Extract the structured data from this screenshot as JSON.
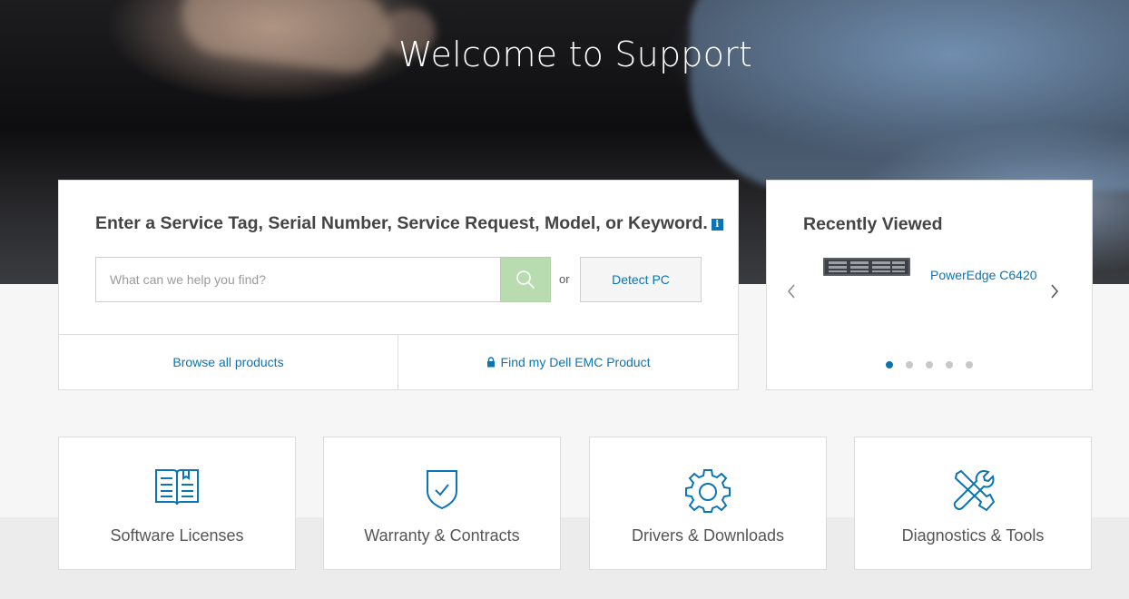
{
  "hero": {
    "title": "Welcome to Support"
  },
  "search": {
    "heading": "Enter a Service Tag, Serial Number, Service Request, Model, or Keyword.",
    "info_icon": "info-icon",
    "placeholder": "What can we help you find?",
    "value": "",
    "search_icon": "search-icon",
    "or_label": "or",
    "detect_label": "Detect PC",
    "browse_label": "Browse all products",
    "find_label": "Find my Dell EMC Product",
    "find_icon": "lock-icon"
  },
  "recent": {
    "title": "Recently Viewed",
    "items": [
      {
        "name": "PowerEdge C6420",
        "image": "server-image"
      }
    ],
    "prev_icon": "chevron-left-icon",
    "next_icon": "chevron-right-icon",
    "page_count": 5,
    "active_page": 1
  },
  "tiles": [
    {
      "label": "Software Licenses",
      "icon": "book-icon"
    },
    {
      "label": "Warranty & Contracts",
      "icon": "shield-check-icon"
    },
    {
      "label": "Drivers & Downloads",
      "icon": "gear-icon"
    },
    {
      "label": "Diagnostics & Tools",
      "icon": "tools-icon"
    }
  ],
  "colors": {
    "accent": "#0b74b4",
    "search_button": "#b9dbb0",
    "background": "#f6f6f6"
  }
}
